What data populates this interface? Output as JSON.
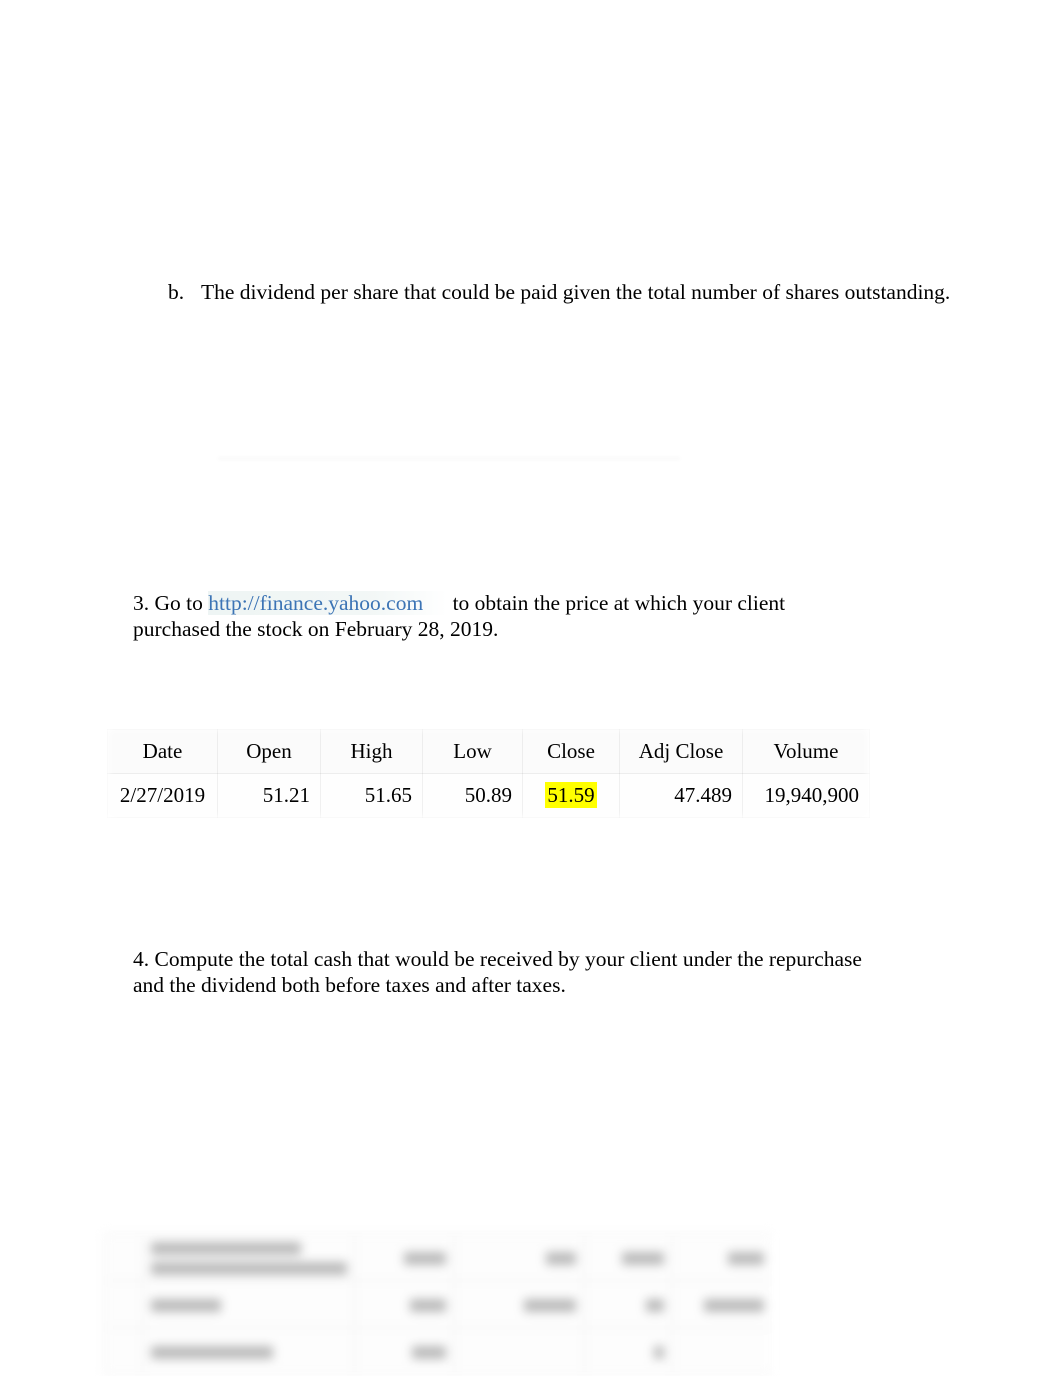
{
  "document": {
    "background_color": "#ffffff",
    "text_color": "#000000",
    "link_color": "#3C74B5",
    "highlight_color": "#ffff00"
  },
  "item_b": {
    "marker": "b.",
    "text": "The dividend per share that could be paid given the total number of shares outstanding."
  },
  "paragraph_3": {
    "lead": "3. Go to ",
    "link_text": "http://finance.yahoo.com",
    "trailing": " to obtain the price at which your client purchased the stock on February 28, 2019."
  },
  "stock_table": {
    "columns": [
      "Date",
      "Open",
      "High",
      "Low",
      "Close",
      "Adj Close",
      "Volume"
    ],
    "rows": [
      {
        "Date": "2/27/2019",
        "Open": "51.21",
        "High": "51.65",
        "Low": "50.89",
        "Close": "51.59",
        "Adj Close": "47.489",
        "Volume": "19,940,900"
      }
    ],
    "highlighted_cell": "Close"
  },
  "paragraph_4": {
    "text": "4. Compute the total cash that would be received by your client under the repurchase and the dividend both before taxes and after taxes."
  },
  "bottom_table": {
    "note": "blurred-illegible",
    "rows": [
      {
        "label_widths": [
          130,
          190
        ],
        "values": [
          "",
          "",
          "",
          ""
        ]
      },
      {
        "label_widths": [
          75
        ],
        "values": [
          "",
          "",
          "",
          ""
        ]
      },
      {
        "label_widths": [
          120
        ],
        "values": [
          "",
          "",
          "",
          ""
        ]
      }
    ]
  }
}
